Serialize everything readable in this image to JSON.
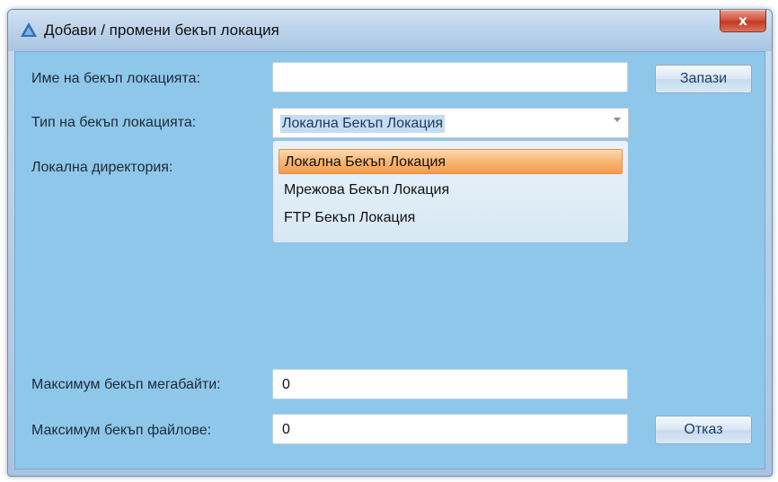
{
  "window": {
    "title": "Добави / промени бекъп локация",
    "close_label": "x"
  },
  "form": {
    "name_label": "Име на бекъп локацията:",
    "name_value": "",
    "type_label": "Тип на бекъп локацията:",
    "type_selected": "Локална Бекъп Локация",
    "local_dir_label": "Локална директория:",
    "max_mb_label": "Максимум бекъп мегабайти:",
    "max_mb_value": "0",
    "max_files_label": "Максимум бекъп файлове:",
    "max_files_value": "0"
  },
  "dropdown": {
    "options": [
      "Локална Бекъп Локация",
      "Мрежова Бекъп Локация",
      "FTP Бекъп Локация"
    ],
    "selected_index": 0
  },
  "buttons": {
    "save_label": "Запази",
    "cancel_label": "Отказ"
  }
}
